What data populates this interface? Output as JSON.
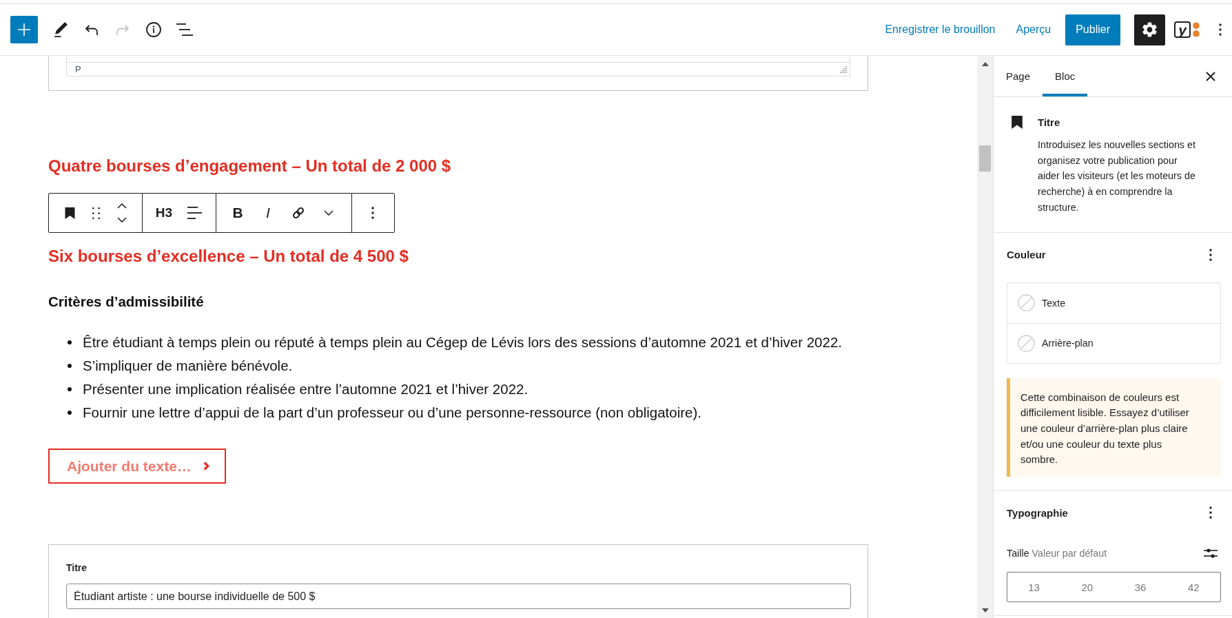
{
  "header": {
    "undo": {
      "disabled": false
    },
    "redo": {
      "disabled": true
    },
    "save_draft": "Enregistrer le brouillon",
    "preview": "Aperçu",
    "publish": "Publier",
    "settings": {
      "pressed": true
    },
    "seo_plugin": {
      "glyph": "y"
    }
  },
  "editor": {
    "top_block": {
      "path": "P"
    },
    "blocks": [
      {
        "kind": "heading",
        "text": "Quatre bourses d’engagement – Un total de 2 000 $"
      },
      {
        "kind": "block_toolbar",
        "heading_level": "H3",
        "formats": [
          {
            "kind": "bold",
            "label": "B"
          },
          {
            "kind": "italic",
            "label": "I"
          }
        ]
      },
      {
        "kind": "heading",
        "text": "Six bourses d’excellence – Un total de 4 500 $"
      },
      {
        "kind": "subheading",
        "text": "Critères d’admissibilité"
      },
      {
        "kind": "list",
        "items": [
          "Être étudiant à temps plein ou réputé à temps plein au Cégep de Lévis lors des sessions d’automne 2021 et d’hiver 2022.",
          "S’impliquer de manière bénévole.",
          "Présenter une implication réalisée entre l’automne 2021 et l’hiver 2022.",
          "Fournir une lettre d’appui de la part d’un professeur ou d’une personne-ressource (non obligatoire)."
        ]
      },
      {
        "kind": "button",
        "label": "Ajouter du texte…"
      },
      {
        "kind": "field_card",
        "label": "Titre",
        "value": "Étudiant artiste : une bourse individuelle de 500 $"
      }
    ]
  },
  "sidebar": {
    "tabs": [
      {
        "label": "Page",
        "selected": false
      },
      {
        "label": "Bloc",
        "selected": true
      }
    ],
    "block": {
      "title": "Titre",
      "description": "Introduisez les nouvelles sections et organisez votre publication pour aider les visiteurs (et les moteurs de recherche) à en comprendre la structure."
    },
    "color": {
      "title": "Couleur",
      "items": [
        {
          "label": "Texte"
        },
        {
          "label": "Arrière-plan"
        }
      ],
      "warning": "Cette combinaison de couleurs est difficilement lisible. Essayez d’utiliser une couleur d’arrière-plan plus claire et/ou une couleur du texte plus sombre."
    },
    "typography": {
      "title": "Typographie",
      "size_label": "Taille",
      "size_value": "Valeur par défaut",
      "sizes": [
        {
          "label": "13",
          "selected": false
        },
        {
          "label": "20",
          "selected": false
        },
        {
          "label": "36",
          "selected": false
        },
        {
          "label": "42",
          "selected": false
        }
      ]
    }
  }
}
